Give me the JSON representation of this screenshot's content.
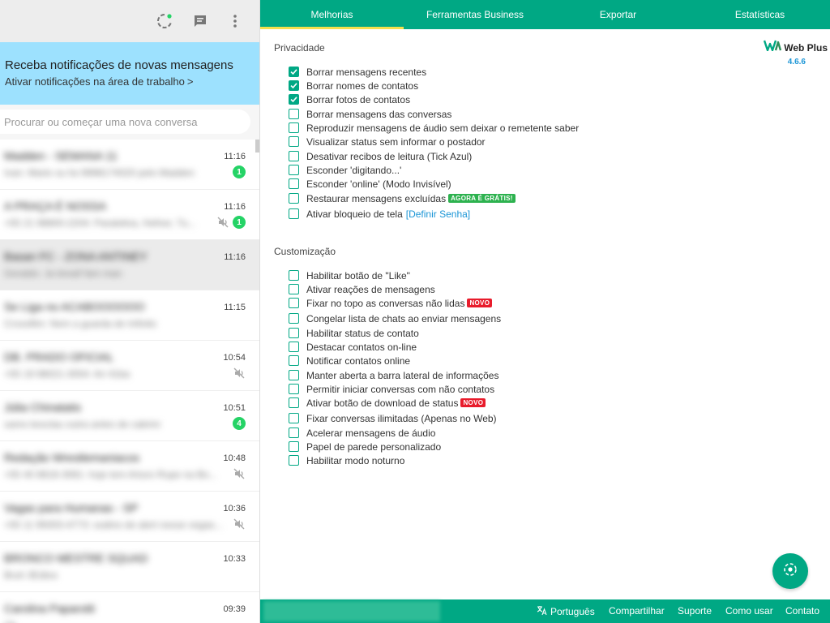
{
  "left": {
    "notification": {
      "title": "Receba notificações de novas mensagens",
      "link": "Ativar notificações na área de trabalho",
      "chevron": ">"
    },
    "search": {
      "placeholder": "Procurar ou começar uma nova conversa"
    },
    "chats": [
      {
        "name": "Madden - SEMANA 11",
        "preview": "Ivan: Marie ou fui 9998174020 pelo Madden",
        "time": "11:16",
        "unread": "1",
        "muted": false,
        "active": false
      },
      {
        "name": "A PRAÇA É NOSSA",
        "preview": "+55 21 98800-2204: Paralelina, Hefner, Tu...",
        "time": "11:16",
        "unread": "1",
        "muted": true,
        "active": false
      },
      {
        "name": "Basan FC - ZONA ANTINEY",
        "preview": "Geraldo: Ja breaif fam man",
        "time": "11:16",
        "unread": "",
        "muted": false,
        "active": true
      },
      {
        "name": "Se Liga no ACABOOOOOO",
        "preview": "Crossfilm: Nem a guarda de Infinito",
        "time": "11:15",
        "unread": "",
        "muted": false,
        "active": false
      },
      {
        "name": "DB. PRADO OFICIAL",
        "preview": "+55 19 98021-3054: Ari 41ba",
        "time": "10:54",
        "unread": "",
        "muted": true,
        "active": false
      },
      {
        "name": "Júlia Chinatatis",
        "preview": "xamo kesclau outra antes de cabrinr",
        "time": "10:51",
        "unread": "4",
        "muted": false,
        "active": false
      },
      {
        "name": "Redação Wrestlemaniacos",
        "preview": "+55 40 8818-3081: hoje tem Arturo Rupe na Bo...",
        "time": "10:48",
        "unread": "",
        "muted": true,
        "active": false
      },
      {
        "name": "Vagas para Humanas - SP",
        "preview": "+55 11 95003-4773: sodino de alert nesse vegas...",
        "time": "10:36",
        "unread": "",
        "muted": true,
        "active": false
      },
      {
        "name": "BRONCO MESTRE SQUAD",
        "preview": "Bruh 3Edtos",
        "time": "10:33",
        "unread": "",
        "muted": false,
        "active": false
      },
      {
        "name": "Carolina Paparotti",
        "preview": "Ok",
        "time": "09:39",
        "unread": "",
        "muted": false,
        "active": false
      }
    ]
  },
  "nav": {
    "tabs": [
      {
        "label": "Melhorias",
        "active": true
      },
      {
        "label": "Ferramentas Business",
        "active": false
      },
      {
        "label": "Exportar",
        "active": false
      },
      {
        "label": "Estatísticas",
        "active": false
      }
    ]
  },
  "brand": {
    "name": "Web Plus",
    "version": "4.6.6"
  },
  "privacy": {
    "title": "Privacidade",
    "options": [
      {
        "label": "Borrar mensagens recentes",
        "checked": true,
        "tag": ""
      },
      {
        "label": "Borrar nomes de contatos",
        "checked": true,
        "tag": ""
      },
      {
        "label": "Borrar fotos de contatos",
        "checked": true,
        "tag": ""
      },
      {
        "label": "Borrar mensagens das conversas",
        "checked": false,
        "tag": ""
      },
      {
        "label": "Reproduzir mensagens de áudio sem deixar o remetente saber",
        "checked": false,
        "tag": ""
      },
      {
        "label": "Visualizar status sem informar o postador",
        "checked": false,
        "tag": ""
      },
      {
        "label": "Desativar recibos de leitura (Tick Azul)",
        "checked": false,
        "tag": ""
      },
      {
        "label": "Esconder 'digitando...'",
        "checked": false,
        "tag": ""
      },
      {
        "label": "Esconder 'online' (Modo Invisível)",
        "checked": false,
        "tag": ""
      },
      {
        "label": "Restaurar mensagens excluídas",
        "checked": false,
        "tag": "AGORA É GRÁTIS!",
        "tag_color": "green"
      },
      {
        "label": "Ativar bloqueio de tela",
        "checked": false,
        "tag": "",
        "link": "[Definir Senha]"
      }
    ]
  },
  "custom": {
    "title": "Customização",
    "options": [
      {
        "label": "Habilitar botão de \"Like\"",
        "checked": false,
        "tag": ""
      },
      {
        "label": "Ativar reações de mensagens",
        "checked": false,
        "tag": ""
      },
      {
        "label": "Fixar no topo as conversas não lidas",
        "checked": false,
        "tag": "NOVO",
        "tag_color": "red"
      },
      {
        "label": "Congelar lista de chats ao enviar mensagens",
        "checked": false,
        "tag": ""
      },
      {
        "label": "Habilitar status de contato",
        "checked": false,
        "tag": ""
      },
      {
        "label": "Destacar contatos on-line",
        "checked": false,
        "tag": ""
      },
      {
        "label": "Notificar contatos online",
        "checked": false,
        "tag": ""
      },
      {
        "label": "Manter aberta a barra lateral de informações",
        "checked": false,
        "tag": ""
      },
      {
        "label": "Permitir iniciar conversas com não contatos",
        "checked": false,
        "tag": ""
      },
      {
        "label": "Ativar botão de download de status",
        "checked": false,
        "tag": "NOVO",
        "tag_color": "red"
      },
      {
        "label": "Fixar conversas ilimitadas (Apenas no Web)",
        "checked": false,
        "tag": ""
      },
      {
        "label": "Acelerar mensagens de áudio",
        "checked": false,
        "tag": ""
      },
      {
        "label": "Papel de parede personalizado",
        "checked": false,
        "tag": ""
      },
      {
        "label": "Habilitar modo noturno",
        "checked": false,
        "tag": ""
      }
    ]
  },
  "footer": {
    "language": "Português",
    "share": "Compartilhar",
    "support": "Suporte",
    "howto": "Como usar",
    "contact": "Contato"
  },
  "colors": {
    "accent": "#00a884",
    "tab_underline": "#f4e04d",
    "notif_bg": "#9de1fe",
    "link": "#1a95d6"
  }
}
